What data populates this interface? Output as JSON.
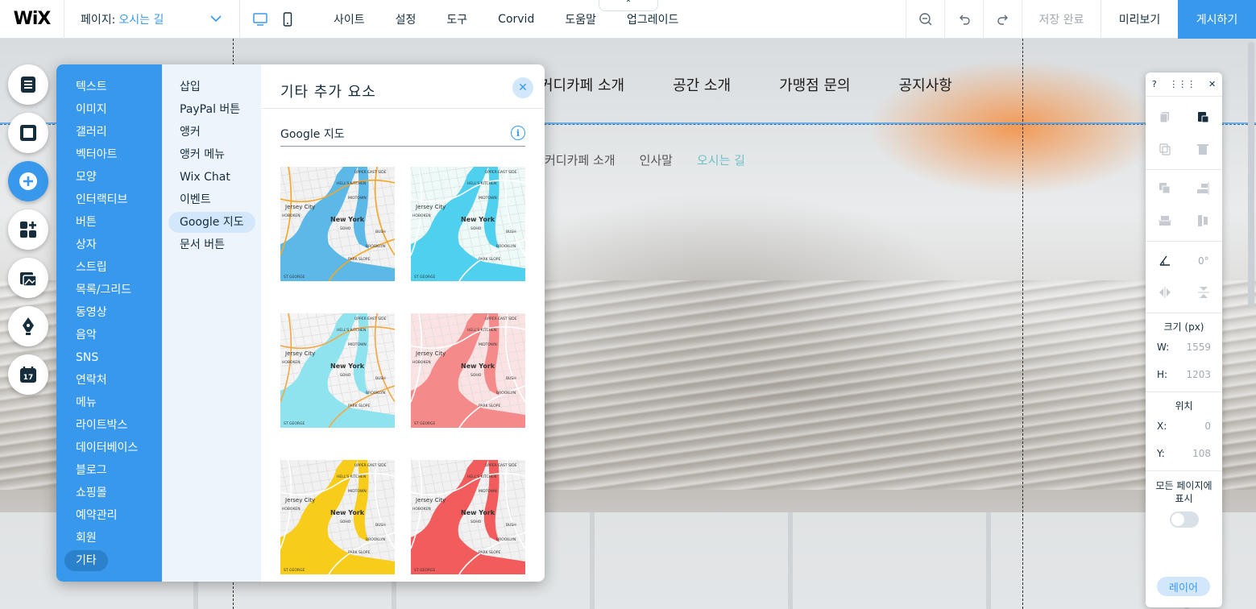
{
  "topbar": {
    "logo": "WiX",
    "page_label": "페이지:",
    "page_value": "오시는 길",
    "menu": [
      "사이트",
      "설정",
      "도구",
      "Corvid",
      "도움말",
      "업그레이드"
    ],
    "collapse_glyph": "⌃",
    "save_status": "저장 완료",
    "preview": "미리보기",
    "publish": "게시하기"
  },
  "site": {
    "nav": [
      "커디카페 소개",
      "공간 소개",
      "가맹점 문의",
      "공지사항"
    ],
    "subnav": [
      "커디카페 소개",
      "인사말",
      "오시는 길"
    ]
  },
  "add_panel": {
    "categories": [
      "텍스트",
      "이미지",
      "갤러리",
      "벡터아트",
      "모양",
      "인터랙티브",
      "버튼",
      "상자",
      "스트립",
      "목록/그리드",
      "동영상",
      "음악",
      "SNS",
      "연락처",
      "메뉴",
      "라이트박스",
      "데이터베이스",
      "블로그",
      "쇼핑몰",
      "예약관리",
      "회원",
      "기타"
    ],
    "subcategories": [
      "삽입",
      "PayPal 버튼",
      "앵커",
      "앵커 메뉴",
      "Wix Chat",
      "이벤트",
      "Google 지도",
      "문서 버튼"
    ],
    "title": "기타 추가 요소",
    "section_title": "Google 지도",
    "info_glyph": "i",
    "close_glyph": "✕",
    "maps": [
      {
        "theme": "colorful",
        "water": "#5cb8e6",
        "land": "#f2f2f2",
        "road": "#f5a623"
      },
      {
        "theme": "aqua",
        "water": "#4fd0ee",
        "land": "#eefaf7",
        "road": "#ffffff"
      },
      {
        "theme": "orange",
        "water": "#8fe3ee",
        "land": "#f4f4f4",
        "road": "#f5a742"
      },
      {
        "theme": "pink",
        "water": "#f48a8a",
        "land": "#fbe3e3",
        "road": "#ffffff"
      },
      {
        "theme": "yellow",
        "water": "#f7cc1a",
        "land": "#f1f1f1",
        "road": "#ffffff"
      },
      {
        "theme": "red",
        "water": "#f25c5c",
        "land": "#f1f1f1",
        "road": "#ffffff"
      }
    ],
    "map_labels": {
      "ny": "New York",
      "jc": "Jersey City",
      "hk": "HELL'S KITCHEN",
      "ue": "UPPER EAST SIDE",
      "mt": "MIDTOWN",
      "so": "SOHO",
      "bk": "BROOKLYN",
      "ps": "PARK SLOPE",
      "hb": "HOBOKEN",
      "bu": "BUSH",
      "sg": "ST GEORGE"
    }
  },
  "inspector": {
    "help": "?",
    "drag": "⋮⋮⋮",
    "close": "✕",
    "rotation": "0°",
    "size_label": "크기 (px)",
    "w_label": "W:",
    "w_value": "1559",
    "h_label": "H:",
    "h_value": "1203",
    "pos_label": "위치",
    "x_label": "X:",
    "x_value": "0",
    "y_label": "Y:",
    "y_value": "108",
    "show_all": "모든 페이지에 표시",
    "layers": "레이어"
  },
  "colors": {
    "accent": "#3899ec",
    "active_cat": "#2b81cb",
    "subnav_active": "#6ec2c9"
  }
}
